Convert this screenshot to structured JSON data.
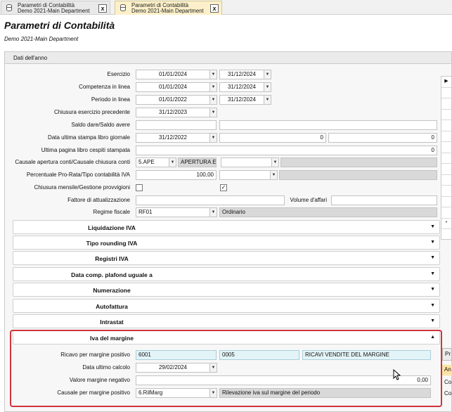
{
  "tabs": [
    {
      "line1": "Parametri di Contabilità",
      "line2": "Demo 2021-Main Department"
    },
    {
      "line1": "Parametri di Contabilità",
      "line2": "Demo 2021-Main Department"
    }
  ],
  "header": {
    "title": "Parametri di Contabilità",
    "subtitle": "Demo 2021-Main Department"
  },
  "panel": {
    "title": "Dati dell'anno"
  },
  "fields": {
    "esercizio": {
      "label": "Esercizio",
      "from": "01/01/2024",
      "to": "31/12/2024"
    },
    "competenza": {
      "label": "Competenza in linea",
      "from": "01/01/2024",
      "to": "31/12/2024"
    },
    "periodo": {
      "label": "Periodo in linea",
      "from": "01/01/2022",
      "to": "31/12/2024"
    },
    "chiusura": {
      "label": "Chiusura esercizio precedente",
      "value": "31/12/2023"
    },
    "saldo": {
      "label": "Saldo dare/Saldo avere"
    },
    "stampa": {
      "label": "Data ultima stampa libro giornale",
      "date": "31/12/2022",
      "v1": "0",
      "v2": "0"
    },
    "cespiti": {
      "label": "Ultima pagina libro cespiti stampata",
      "value": "0"
    },
    "causale": {
      "label": "Causale apertura conti/Causale chiusura conti",
      "code": "5.APE",
      "desc": "APERTURA ES"
    },
    "prorata": {
      "label": "Percentuale Pro-Rata/Tipo contabilità IVA",
      "value": "100,00"
    },
    "mensile": {
      "label": "Chiusura mensile/Gestione provvigioni",
      "check1": "",
      "check2": "✓"
    },
    "fattore": {
      "label": "Fattore di attualizzazione",
      "volume_label": "Volume d'affari"
    },
    "regime": {
      "label": "Regime fiscale",
      "code": "RF01",
      "desc": "Ordinario"
    }
  },
  "sections": [
    "Liquidazione IVA",
    "Tipo rounding IVA",
    "Registri IVA",
    "Data comp. plafond uguale a",
    "Numerazione",
    "Autofattura",
    "Intrastat"
  ],
  "iva_margine": {
    "title": "Iva del margine",
    "ricavo": {
      "label": "Ricavo per margine positivo",
      "v1": "6001",
      "v2": "0005",
      "v3": "RICAVI VENDITE DEL MARGINE"
    },
    "data": {
      "label": "Data ultimo calcolo",
      "value": "29/02/2024"
    },
    "valore": {
      "label": "Valore margine negativo",
      "value": "0,00"
    },
    "causale": {
      "label": "Causale per margine positivo",
      "code": "6.RilMarg",
      "desc": "Rilevazione iva sul margine del periodo"
    }
  },
  "right_side": {
    "btn": "Pr",
    "items": [
      "An",
      "Co",
      "Co"
    ]
  }
}
